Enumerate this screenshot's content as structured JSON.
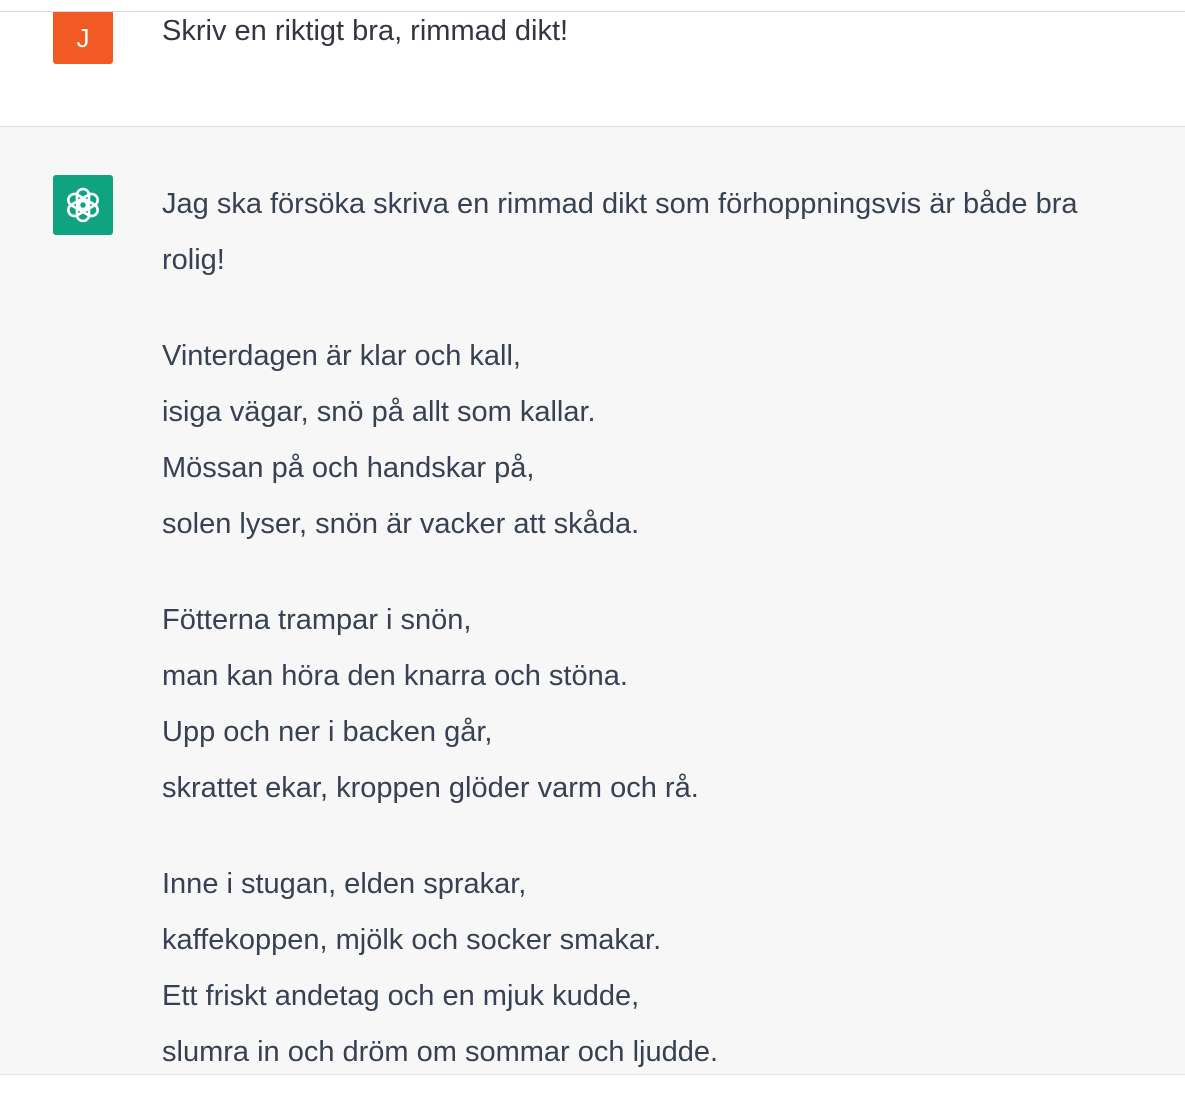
{
  "user": {
    "avatar_letter": "J",
    "avatar_color": "#f15a22",
    "message": "Skriv en riktigt bra, rimmad dikt!"
  },
  "assistant": {
    "avatar_icon": "openai-logo-icon",
    "avatar_color": "#10a37f",
    "intro_line1": "Jag ska försöka skriva en rimmad dikt som förhoppningsvis är både bra",
    "intro_line2": "rolig!",
    "stanzas": [
      {
        "lines": [
          "Vinterdagen är klar och kall,",
          "isiga vägar, snö på allt som kallar.",
          "Mössan på och handskar på,",
          "solen lyser, snön är vacker att skåda."
        ]
      },
      {
        "lines": [
          "Fötterna trampar i snön,",
          "man kan höra den knarra och stöna.",
          "Upp och ner i backen går,",
          "skrattet ekar, kroppen glöder varm och rå."
        ]
      },
      {
        "lines": [
          "Inne i stugan, elden sprakar,",
          "kaffekoppen, mjölk och socker smakar.",
          "Ett friskt andetag och en mjuk kudde,",
          "slumra in och dröm om sommar och ljudde."
        ]
      }
    ]
  }
}
